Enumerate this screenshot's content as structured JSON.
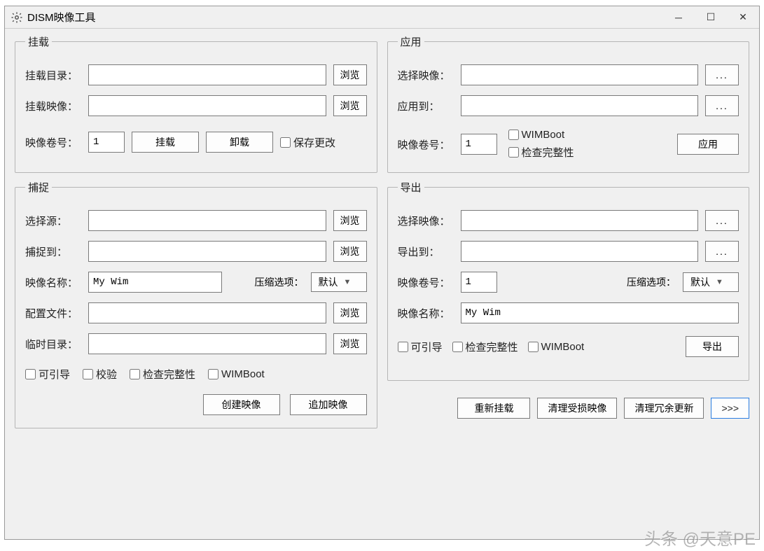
{
  "title": "DISM映像工具",
  "mount": {
    "legend": "挂载",
    "dir_label": "挂载目录：",
    "dir_value": "",
    "img_label": "挂载映像：",
    "img_value": "",
    "vol_label": "映像卷号：",
    "vol_value": "1",
    "browse": "浏览",
    "mount_btn": "挂载",
    "unmount_btn": "卸载",
    "save_changes": "保存更改"
  },
  "apply": {
    "legend": "应用",
    "select_label": "选择映像：",
    "select_value": "",
    "applyto_label": "应用到：",
    "applyto_value": "",
    "vol_label": "映像卷号：",
    "vol_value": "1",
    "wimboot": "WIMBoot",
    "verify": "检查完整性",
    "apply_btn": "应用",
    "ellipsis": "..."
  },
  "capture": {
    "legend": "捕捉",
    "src_label": "选择源：",
    "src_value": "",
    "to_label": "捕捉到：",
    "to_value": "",
    "name_label": "映像名称：",
    "name_value": "My Wim",
    "compress_label": "压缩选项：",
    "compress_value": "默认",
    "config_label": "配置文件：",
    "config_value": "",
    "temp_label": "临时目录：",
    "temp_value": "",
    "bootable": "可引导",
    "check": "校验",
    "verify": "检查完整性",
    "wimboot": "WIMBoot",
    "browse": "浏览",
    "create_btn": "创建映像",
    "append_btn": "追加映像"
  },
  "export": {
    "legend": "导出",
    "select_label": "选择映像：",
    "select_value": "",
    "to_label": "导出到：",
    "to_value": "",
    "vol_label": "映像卷号：",
    "vol_value": "1",
    "compress_label": "压缩选项：",
    "compress_value": "默认",
    "name_label": "映像名称：",
    "name_value": "My Wim",
    "bootable": "可引导",
    "verify": "检查完整性",
    "wimboot": "WIMBoot",
    "export_btn": "导出",
    "ellipsis": "..."
  },
  "footer": {
    "remount": "重新挂载",
    "cleanup_corrupt": "清理受损映像",
    "cleanup_updates": "清理冗余更新",
    "more": ">>>"
  },
  "watermark": "头条 @天意PE"
}
